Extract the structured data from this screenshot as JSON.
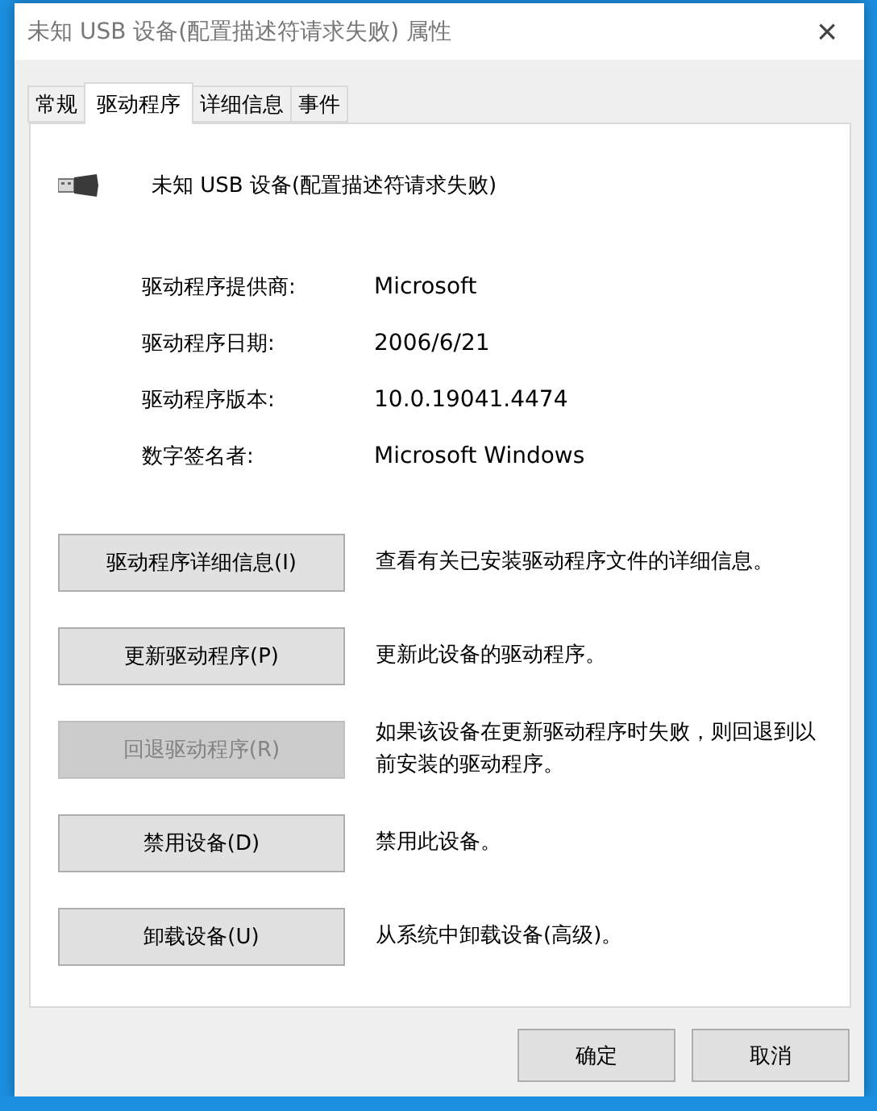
{
  "window": {
    "title": "未知 USB 设备(配置描述符请求失败) 属性",
    "close": "×"
  },
  "tabs": [
    {
      "label": "常规",
      "selected": false
    },
    {
      "label": "驱动程序",
      "selected": true
    },
    {
      "label": "详细信息",
      "selected": false
    },
    {
      "label": "事件",
      "selected": false
    }
  ],
  "device": {
    "name": "未知 USB 设备(配置描述符请求失败)"
  },
  "properties": [
    {
      "label": "驱动程序提供商:",
      "value": "Microsoft"
    },
    {
      "label": "驱动程序日期:",
      "value": "2006/6/21"
    },
    {
      "label": "驱动程序版本:",
      "value": "10.0.19041.4474"
    },
    {
      "label": "数字签名者:",
      "value": "Microsoft Windows"
    }
  ],
  "actions": [
    {
      "button": "驱动程序详细信息(I)",
      "disabled": false,
      "description": "查看有关已安装驱动程序文件的详细信息。"
    },
    {
      "button": "更新驱动程序(P)",
      "disabled": false,
      "description": "更新此设备的驱动程序。"
    },
    {
      "button": "回退驱动程序(R)",
      "disabled": true,
      "description": "如果该设备在更新驱动程序时失败，则回退到以前安装的驱动程序。"
    },
    {
      "button": "禁用设备(D)",
      "disabled": false,
      "description": "禁用此设备。"
    },
    {
      "button": "卸载设备(U)",
      "disabled": false,
      "description": "从系统中卸载设备(高级)。"
    }
  ],
  "buttons": [
    "确定",
    "取消"
  ]
}
